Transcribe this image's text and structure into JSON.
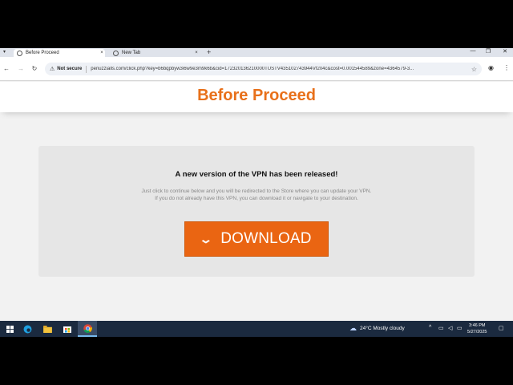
{
  "browser": {
    "tabs": [
      {
        "title": "Before Proceed",
        "active": true
      },
      {
        "title": "New Tab",
        "active": false
      }
    ],
    "new_tab_symbol": "+",
    "close_symbol": "×",
    "window_controls": [
      "—",
      "❐",
      "✕"
    ],
    "security_label": "Not secure",
    "url": "penuzzialls.com/click.php?key=b6bqpbyw3i6w9e3m9k6b&cid=172320136210000TUSTV435102743944Vf204c&cost=0.001544589&zone=4364579-3..."
  },
  "page": {
    "title": "Before Proceed",
    "heading": "A new version of the VPN has been released!",
    "body_line1": "Just click to continue below and you will be redirected to the Store where you can update your VPN.",
    "body_line2": "If you do not already have this VPN, you can download it or navigate to your destination.",
    "download_label": "DOWNLOAD",
    "accent_color": "#e8701a"
  },
  "taskbar": {
    "weather": "24°C  Mostly cloudy",
    "time": "3:46 PM",
    "date": "5/27/2025"
  }
}
